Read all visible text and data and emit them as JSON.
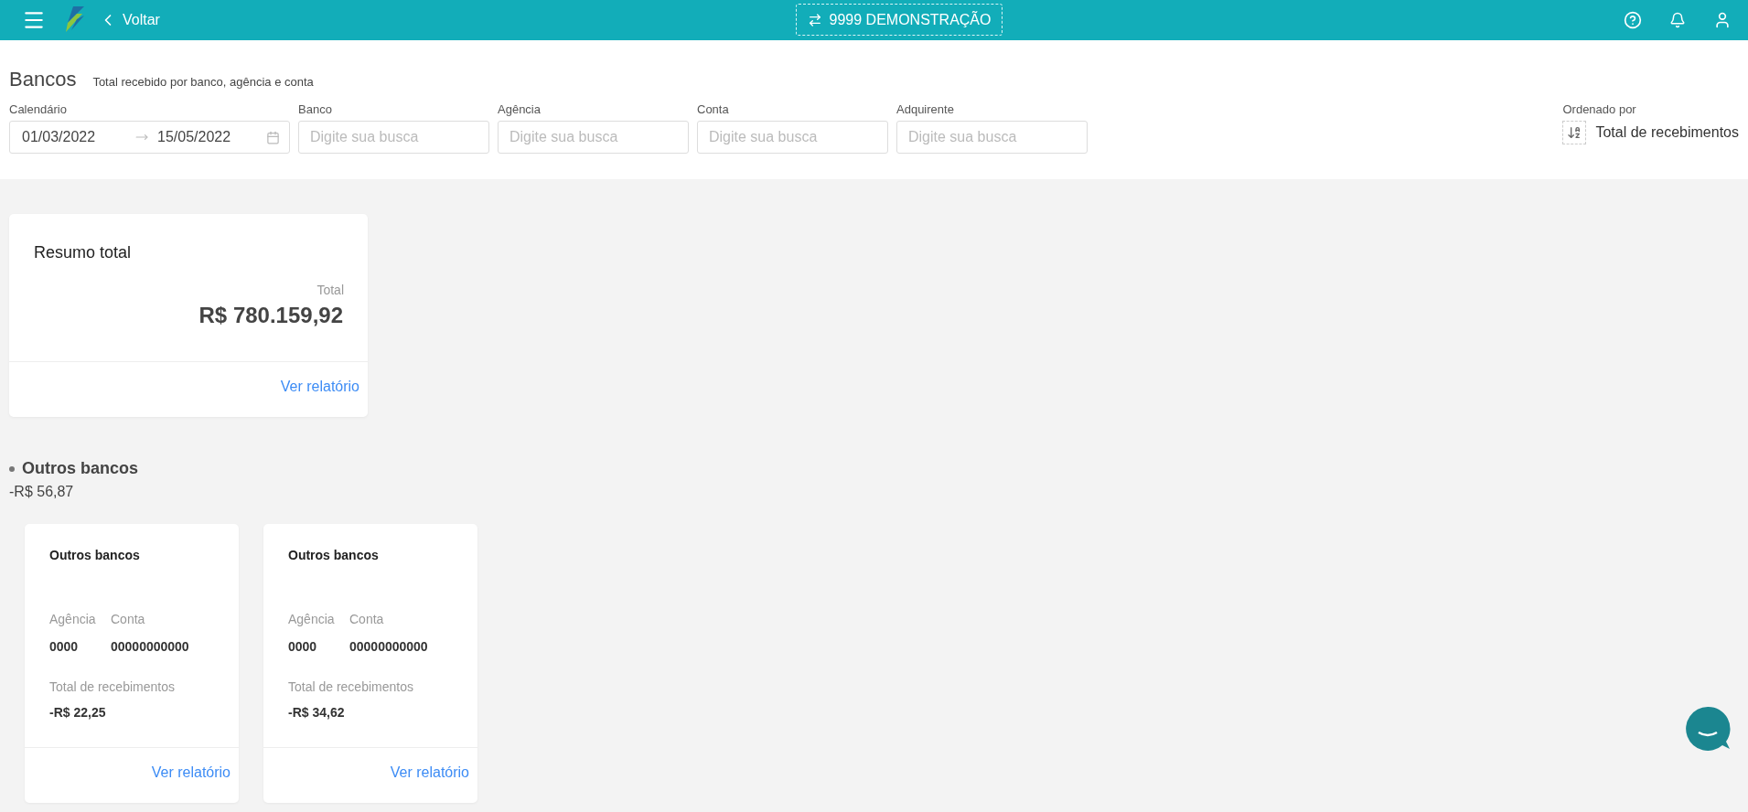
{
  "header": {
    "back": "Voltar",
    "company": "9999 DEMONSTRAÇÃO"
  },
  "page": {
    "title": "Bancos",
    "subtitle": "Total recebido por banco, agência e conta"
  },
  "filters": {
    "calendar": {
      "label": "Calendário",
      "start": "01/03/2022",
      "end": "15/05/2022"
    },
    "fields": [
      {
        "label": "Banco",
        "placeholder": "Digite sua busca"
      },
      {
        "label": "Agência",
        "placeholder": "Digite sua busca"
      },
      {
        "label": "Conta",
        "placeholder": "Digite sua busca"
      },
      {
        "label": "Adquirente",
        "placeholder": "Digite sua busca"
      }
    ],
    "sort": {
      "label": "Ordenado por",
      "value": "Total de recebimentos"
    }
  },
  "summary": {
    "title": "Resumo total",
    "total_label": "Total",
    "total": "R$ 780.159,92",
    "link": "Ver relatório"
  },
  "groups": [
    {
      "name": "Outros bancos",
      "total": "-R$ 56,87",
      "accounts": [
        {
          "bank": "Outros bancos",
          "agency_label": "Agência",
          "agency": "0000",
          "account_label": "Conta",
          "account": "00000000000",
          "total_label": "Total de recebimentos",
          "total": "-R$ 22,25",
          "link": "Ver relatório"
        },
        {
          "bank": "Outros bancos",
          "agency_label": "Agência",
          "agency": "0000",
          "account_label": "Conta",
          "account": "00000000000",
          "total_label": "Total de recebimentos",
          "total": "-R$ 34,62",
          "link": "Ver relatório"
        }
      ]
    }
  ]
}
